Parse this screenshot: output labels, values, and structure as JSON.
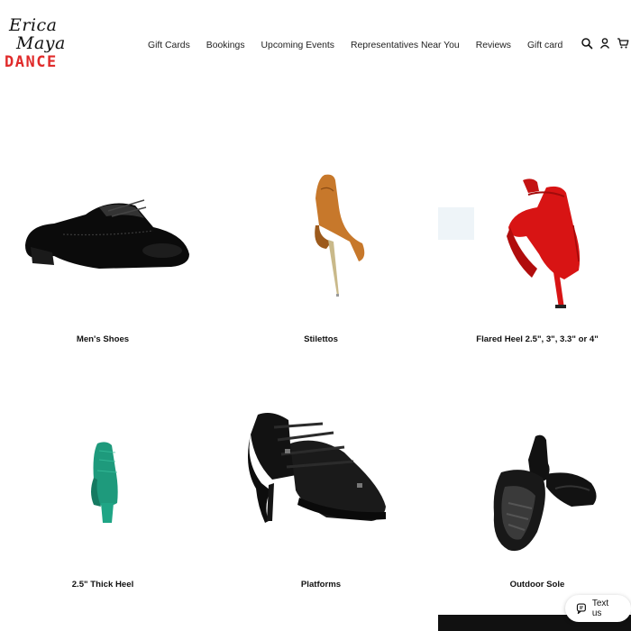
{
  "brand": {
    "line1": "Erica",
    "line2": "Maya",
    "line3": "DANCE",
    "accent_color": "#e02b2b"
  },
  "nav": {
    "items": [
      "Gift Cards",
      "Bookings",
      "Upcoming Events",
      "Representatives Near You",
      "Reviews",
      "Gift card"
    ]
  },
  "header_icons": [
    "search-icon",
    "account-icon",
    "cart-icon"
  ],
  "categories": [
    {
      "label": "Men's Shoes"
    },
    {
      "label": "Stilettos"
    },
    {
      "label": "Flared Heel 2.5\", 3\", 3.3\" or 4\""
    },
    {
      "label": "2.5\" Thick Heel"
    },
    {
      "label": "Platforms"
    },
    {
      "label": "Outdoor Sole"
    }
  ],
  "chat_widget": {
    "label": "Text us"
  }
}
